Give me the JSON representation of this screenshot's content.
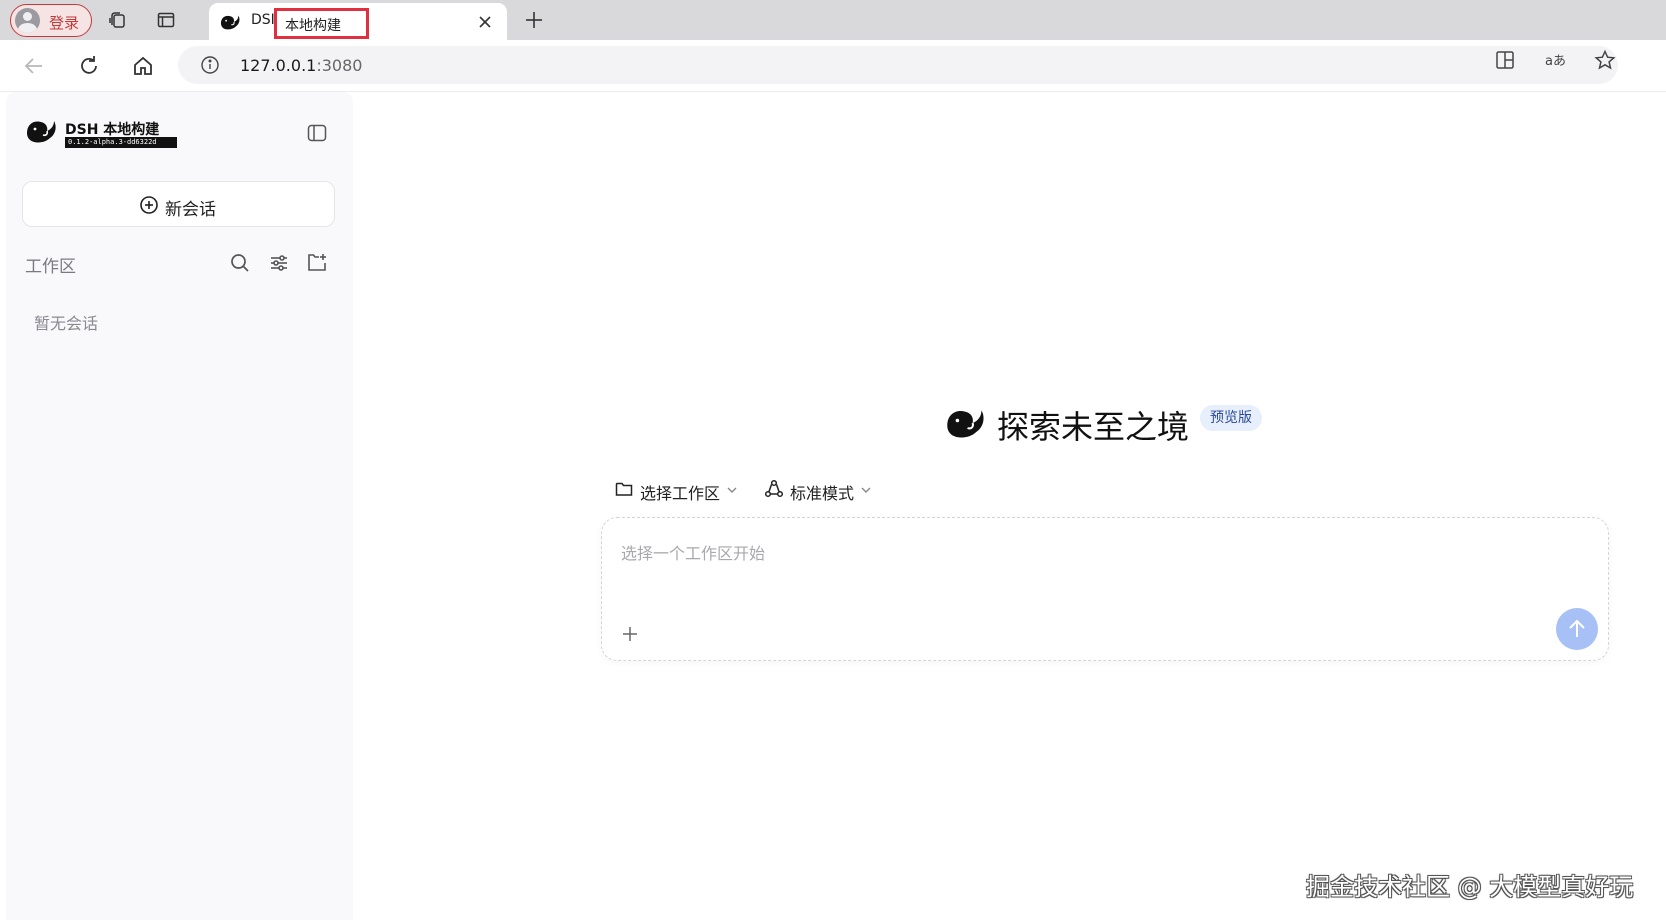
{
  "browser": {
    "login_label": "登录",
    "tab_title_prefix": "DSI",
    "tab_title_highlight": "本地构建",
    "url_host": "127.0.0.1",
    "url_port": ":3080"
  },
  "sidebar": {
    "brand_name": "DSH 本地构建",
    "brand_version": "0.1.2-alpha.3-dd6322d",
    "new_chat_label": "新会话",
    "workspace_label": "工作区",
    "empty_label": "暂无会话"
  },
  "main": {
    "hero_title": "探索未至之境",
    "hero_badge": "预览版",
    "select_workspace_label": "选择工作区",
    "mode_label": "标准模式",
    "composer_placeholder": "选择一个工作区开始"
  },
  "watermark": "掘金技术社区 @ 大模型真好玩",
  "colors": {
    "login_red": "#c33a3a",
    "highlight_red": "#e03040",
    "send_button": "#a7c0f5",
    "badge_bg": "#e7eefc",
    "badge_text": "#2a4c9a"
  },
  "icons": {
    "tabbar": [
      "user-avatar-icon",
      "collections-icon",
      "tab-actions-icon",
      "whale-icon",
      "close-icon",
      "plus-icon"
    ],
    "addressbar": [
      "back-arrow-icon",
      "refresh-icon",
      "home-icon",
      "info-icon",
      "split-screen-icon",
      "translate-icon",
      "favorite-star-icon"
    ],
    "sidebar": [
      "whale-logo-icon",
      "sidebar-toggle-icon",
      "plus-circle-icon",
      "search-icon",
      "filter-sliders-icon",
      "new-folder-icon"
    ],
    "main": [
      "whale-logo-icon",
      "folder-icon",
      "chevron-down-icon",
      "mode-icon",
      "plus-icon",
      "arrow-up-icon"
    ]
  }
}
